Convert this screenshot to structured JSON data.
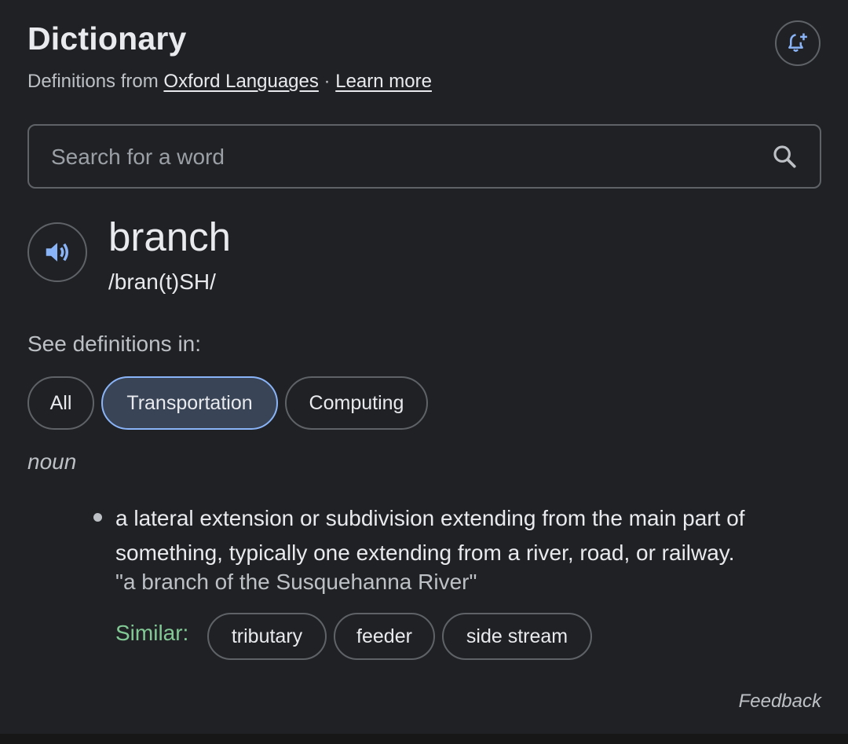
{
  "header": {
    "title": "Dictionary",
    "definitions_from": "Definitions from",
    "source_link": "Oxford Languages",
    "separator": " · ",
    "learn_more": "Learn more"
  },
  "search": {
    "placeholder": "Search for a word"
  },
  "entry": {
    "word": "branch",
    "phonetic": "/bran(t)SH/"
  },
  "categories": {
    "label": "See definitions in:",
    "chips": [
      "All",
      "Transportation",
      "Computing"
    ],
    "selected": "Transportation"
  },
  "sense": {
    "part_of_speech": "noun",
    "definition": "a lateral extension or subdivision extending from the main part of something, typically one extending from a river, road, or railway.",
    "example": "\"a branch of the Susquehanna River\"",
    "similar_label": "Similar:",
    "similar": [
      "tributary",
      "feeder",
      "side stream"
    ]
  },
  "footer": {
    "feedback": "Feedback"
  },
  "colors": {
    "accent": "#8ab4f8",
    "similar": "#81c995",
    "background": "#202124"
  },
  "icons": [
    "add-alert-icon",
    "search-icon",
    "speaker-icon"
  ]
}
